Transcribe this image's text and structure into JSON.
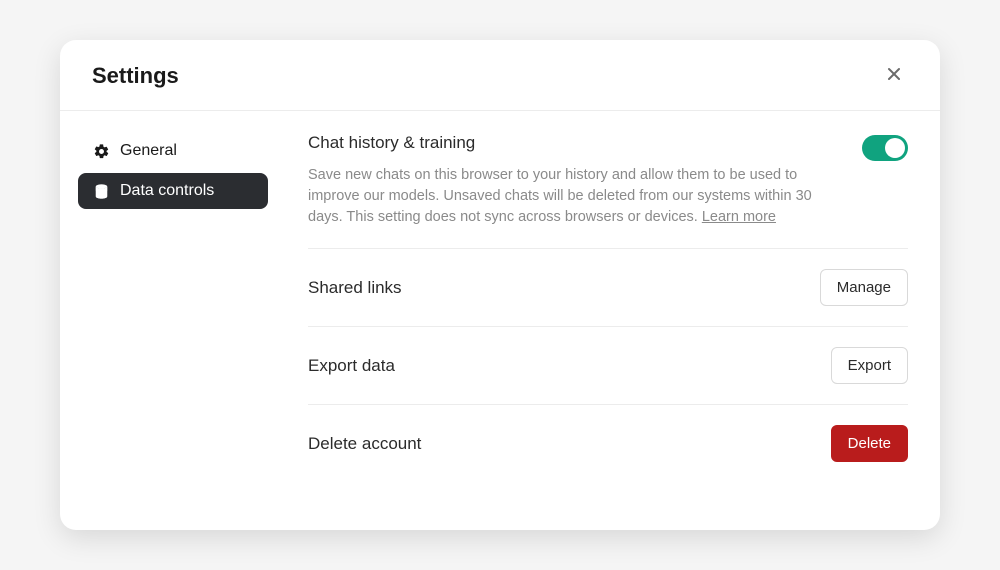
{
  "modal": {
    "title": "Settings"
  },
  "sidebar": {
    "items": [
      {
        "label": "General"
      },
      {
        "label": "Data controls"
      }
    ]
  },
  "sections": {
    "chat_history": {
      "title": "Chat history & training",
      "description": "Save new chats on this browser to your history and allow them to be used to improve our models. Unsaved chats will be deleted from our systems within 30 days. This setting does not sync across browsers or devices. ",
      "learn_more": "Learn more",
      "toggle_on": true
    },
    "shared_links": {
      "title": "Shared links",
      "button": "Manage"
    },
    "export_data": {
      "title": "Export data",
      "button": "Export"
    },
    "delete_account": {
      "title": "Delete account",
      "button": "Delete"
    }
  },
  "colors": {
    "accent": "#10a37f",
    "danger": "#b91c1c",
    "sidebar_active": "#2b2d31"
  }
}
